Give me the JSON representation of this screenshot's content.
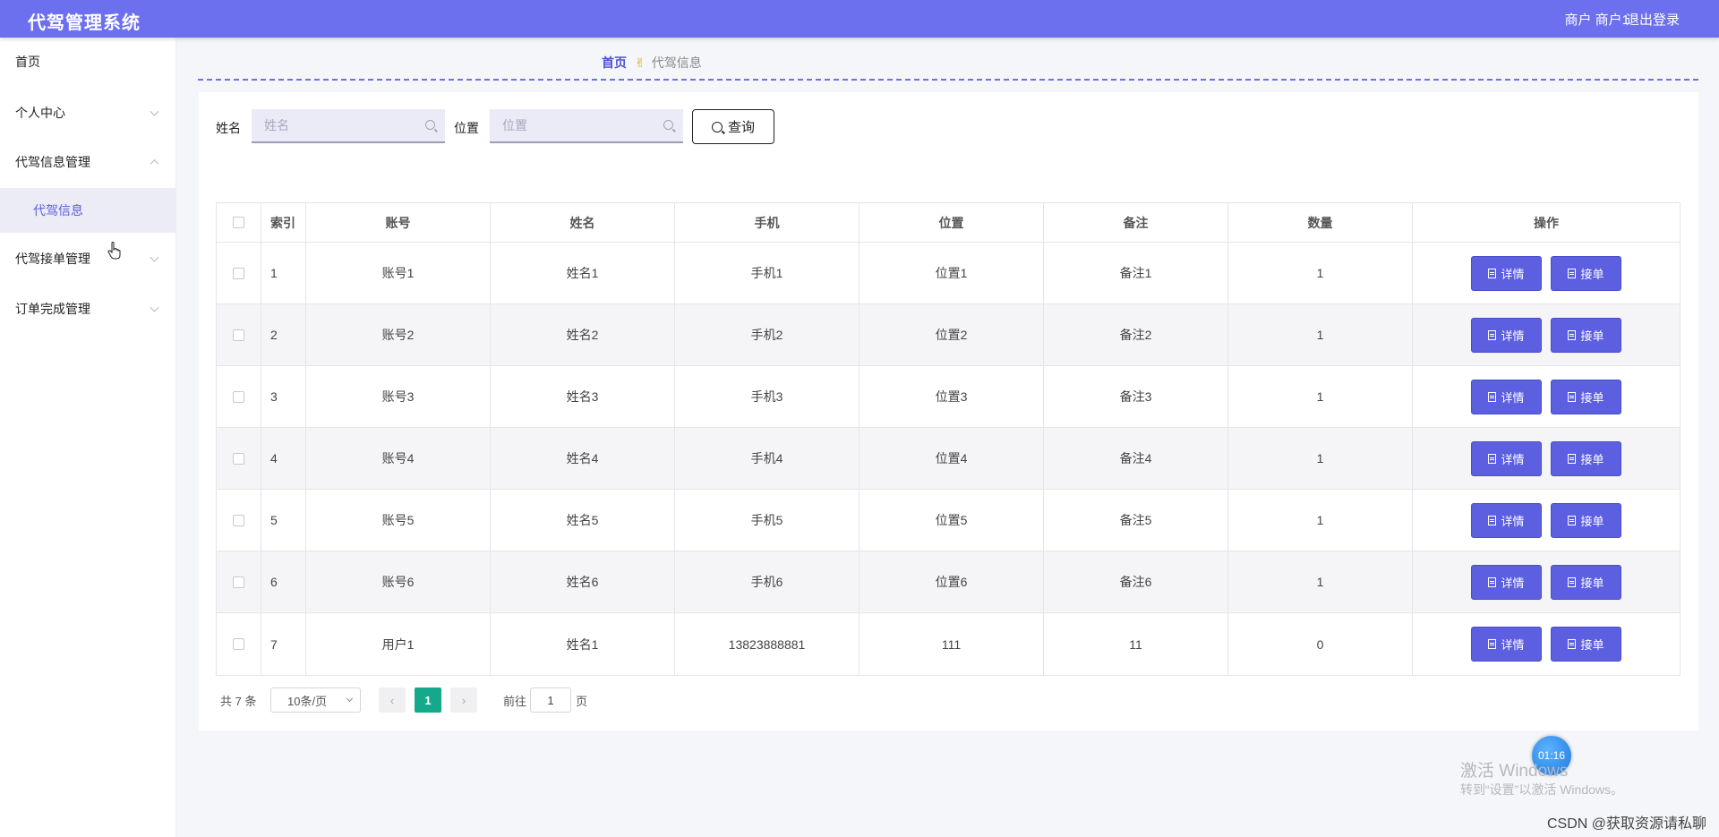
{
  "header": {
    "title": "代驾管理系统",
    "user": "商户 商户1",
    "logout": "退出登录"
  },
  "sidebar": {
    "items": [
      {
        "label": "首页"
      },
      {
        "label": "个人中心"
      },
      {
        "label": "代驾信息管理"
      },
      {
        "label": "代驾接单管理"
      },
      {
        "label": "订单完成管理"
      }
    ],
    "sub_item": "代驾信息"
  },
  "breadcrumb": {
    "home": "首页",
    "current": "代驾信息"
  },
  "search": {
    "name_label": "姓名",
    "name_placeholder": "姓名",
    "loc_label": "位置",
    "loc_placeholder": "位置",
    "button": "查询"
  },
  "table": {
    "headers": [
      "索引",
      "账号",
      "姓名",
      "手机",
      "位置",
      "备注",
      "数量",
      "操作"
    ],
    "rows": [
      [
        "1",
        "账号1",
        "姓名1",
        "手机1",
        "位置1",
        "备注1",
        "1"
      ],
      [
        "2",
        "账号2",
        "姓名2",
        "手机2",
        "位置2",
        "备注2",
        "1"
      ],
      [
        "3",
        "账号3",
        "姓名3",
        "手机3",
        "位置3",
        "备注3",
        "1"
      ],
      [
        "4",
        "账号4",
        "姓名4",
        "手机4",
        "位置4",
        "备注4",
        "1"
      ],
      [
        "5",
        "账号5",
        "姓名5",
        "手机5",
        "位置5",
        "备注5",
        "1"
      ],
      [
        "6",
        "账号6",
        "姓名6",
        "手机6",
        "位置6",
        "备注6",
        "1"
      ],
      [
        "7",
        "用户1",
        "姓名1",
        "13823888881",
        "111",
        "11",
        "0"
      ]
    ],
    "btn_detail": "详情",
    "btn_accept": "接单"
  },
  "pagination": {
    "total": "共 7 条",
    "page_size": "10条/页",
    "current": "1",
    "goto_label": "前往",
    "goto_value": "1",
    "page_suffix": "页"
  },
  "overlay": {
    "timer": "01:16",
    "activate_title": "激活 Windows",
    "activate_sub": "转到“设置”以激活 Windows。",
    "csdn": "CSDN @获取资源请私聊"
  },
  "colors": {
    "header": "#6c6fee",
    "button": "#5c5fe0",
    "active_page": "#13a98a"
  }
}
